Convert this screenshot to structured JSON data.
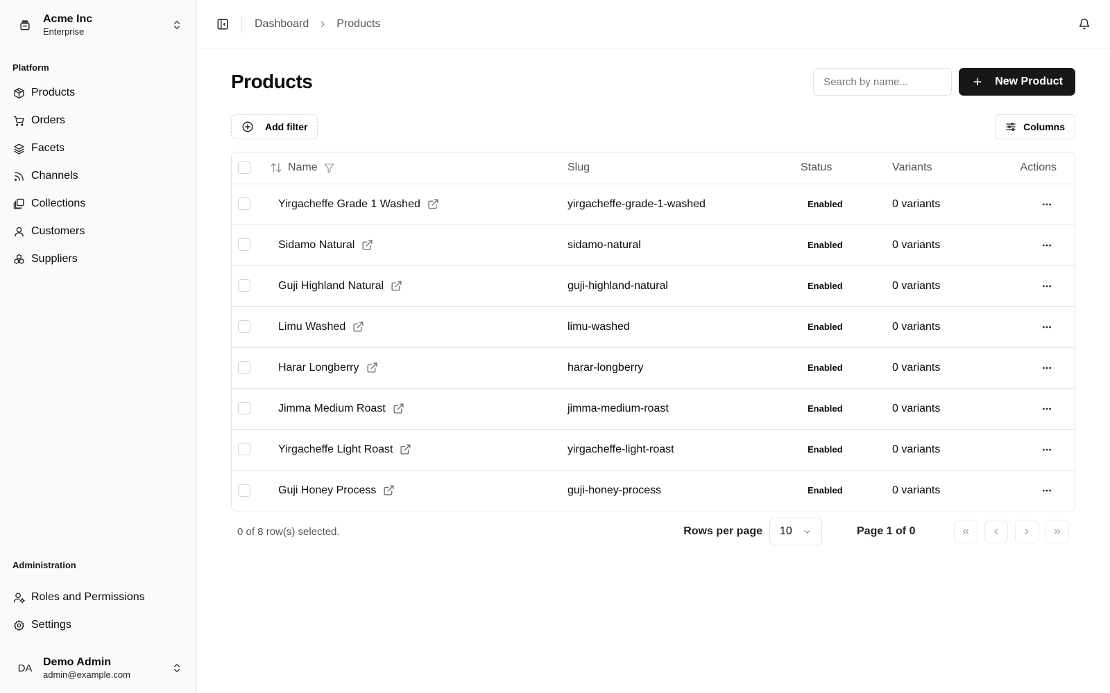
{
  "org": {
    "name": "Acme Inc",
    "plan": "Enterprise"
  },
  "sidebar": {
    "platform_label": "Platform",
    "items": [
      {
        "label": "Products",
        "icon": "package-icon"
      },
      {
        "label": "Orders",
        "icon": "cart-icon"
      },
      {
        "label": "Facets",
        "icon": "layers-icon"
      },
      {
        "label": "Channels",
        "icon": "rss-icon"
      },
      {
        "label": "Collections",
        "icon": "collections-icon"
      },
      {
        "label": "Customers",
        "icon": "user-icon"
      },
      {
        "label": "Suppliers",
        "icon": "boxes-icon"
      }
    ],
    "admin_label": "Administration",
    "admin_items": [
      {
        "label": "Roles and Permissions",
        "icon": "user-cog-icon"
      },
      {
        "label": "Settings",
        "icon": "gear-icon"
      }
    ]
  },
  "user": {
    "initials": "DA",
    "name": "Demo Admin",
    "email": "admin@example.com"
  },
  "breadcrumb": {
    "parent": "Dashboard",
    "current": "Products"
  },
  "page": {
    "title": "Products",
    "search_placeholder": "Search by name...",
    "new_button": "New Product",
    "add_filter": "Add filter",
    "columns_button": "Columns"
  },
  "table": {
    "headers": {
      "name": "Name",
      "slug": "Slug",
      "status": "Status",
      "variants": "Variants",
      "actions": "Actions"
    },
    "rows": [
      {
        "name": "Yirgacheffe Grade 1 Washed",
        "slug": "yirgacheffe-grade-1-washed",
        "status": "Enabled",
        "variants": "0 variants"
      },
      {
        "name": "Sidamo Natural",
        "slug": "sidamo-natural",
        "status": "Enabled",
        "variants": "0 variants"
      },
      {
        "name": "Guji Highland Natural",
        "slug": "guji-highland-natural",
        "status": "Enabled",
        "variants": "0 variants"
      },
      {
        "name": "Limu Washed",
        "slug": "limu-washed",
        "status": "Enabled",
        "variants": "0 variants"
      },
      {
        "name": "Harar Longberry",
        "slug": "harar-longberry",
        "status": "Enabled",
        "variants": "0 variants"
      },
      {
        "name": "Jimma Medium Roast",
        "slug": "jimma-medium-roast",
        "status": "Enabled",
        "variants": "0 variants"
      },
      {
        "name": "Yirgacheffe Light Roast",
        "slug": "yirgacheffe-light-roast",
        "status": "Enabled",
        "variants": "0 variants"
      },
      {
        "name": "Guji Honey Process",
        "slug": "guji-honey-process",
        "status": "Enabled",
        "variants": "0 variants"
      }
    ]
  },
  "footer": {
    "selected": "0 of 8 row(s) selected.",
    "rows_per_page_label": "Rows per page",
    "rows_per_page": "10",
    "page_info": "Page 1 of 0"
  }
}
